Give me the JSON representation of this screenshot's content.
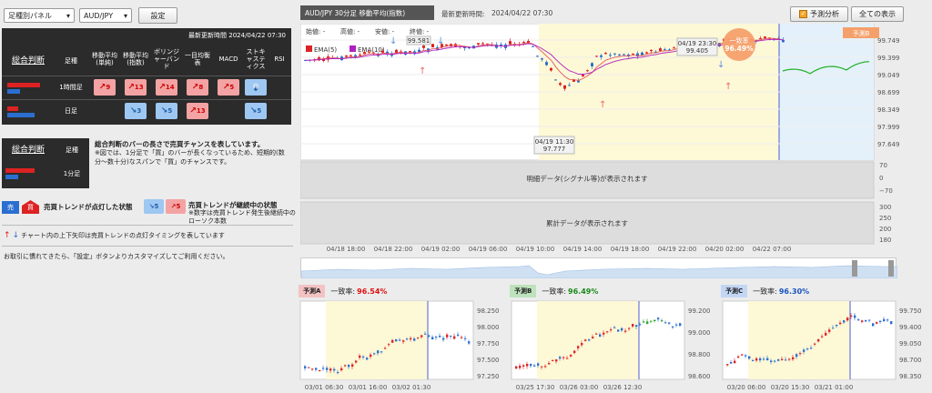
{
  "controls": {
    "panel_select": "足種別パネル",
    "pair_select": "AUD/JPY",
    "settings": "設定"
  },
  "signal_panel": {
    "updated": "最新更新時間 2024/04/22 07:30",
    "col_overall": "総合判断",
    "col_timeframe": "足種",
    "indicators": [
      "移動平均(単純)",
      "移動平均(指数)",
      "ボリンジャーバンド",
      "一目均衡表",
      "MACD",
      "ストキャスティクス",
      "RSI"
    ],
    "rows": [
      {
        "tf": "1時間足",
        "signals": [
          {
            "dir": "up",
            "n": "9"
          },
          {
            "dir": "up",
            "n": "13"
          },
          {
            "dir": "up",
            "n": "14"
          },
          {
            "dir": "up",
            "n": "8"
          },
          {
            "dir": "up",
            "n": "5"
          },
          {
            "dir": "sell",
            "n": "売"
          },
          {
            "dir": "none",
            "n": ""
          }
        ]
      },
      {
        "tf": "日足",
        "signals": [
          {
            "dir": "none",
            "n": ""
          },
          {
            "dir": "down",
            "n": "3"
          },
          {
            "dir": "down",
            "n": "5"
          },
          {
            "dir": "up",
            "n": "13"
          },
          {
            "dir": "none",
            "n": ""
          },
          {
            "dir": "down",
            "n": "5"
          },
          {
            "dir": "none",
            "n": ""
          }
        ]
      }
    ]
  },
  "legend": {
    "overall": "総合判断",
    "tf": "足種",
    "tf_value": "1分足",
    "desc_title": "総合判断のバーの長さで売買チャンスを表しています。",
    "desc_1": "※図では、1分足で「買」のバーが長くなっているため、短期的(数分〜数十分)なスパンで「買」のチャンスです。",
    "sell": "売",
    "buy": "買",
    "lit_text": "売買トレンドが点灯した状態",
    "cont_num": "5",
    "cont_text": "売買トレンドが継続中の状態",
    "cont_sub": "※数字は売買トレンド発生後継続中のローソク本数",
    "arrow_text": "チャート内の上下矢印は売買トレンドの点灯タイミングを表しています",
    "custom_text": "お取引に慣れてきたら、「設定」ボタンよりカスタマイズしてご利用ください。"
  },
  "main_chart": {
    "title": "AUD/JPY 30分足 移動平均(指数)",
    "updated_label": "最新更新時間:",
    "updated": "2024/04/22 07:30",
    "btn_predict": "予測分析",
    "btn_all": "全ての表示",
    "ohlc": {
      "open": "始値: -",
      "high": "高値: -",
      "low": "安値: -",
      "close": "終値: -"
    },
    "ema5": "EMA(5)",
    "ema10": "EMA(10)",
    "pred_tag": "予測B",
    "callout1": {
      "time": "04/19 23:30",
      "val": "99.405"
    },
    "callout2": {
      "time": "04/19 11:30",
      "val": "97.777"
    },
    "callout3": "99.581",
    "match_label": "一致率",
    "match_val": "96.49%",
    "y_ticks": [
      "99.749",
      "99.399",
      "99.049",
      "98.699",
      "98.349",
      "97.999",
      "97.649"
    ],
    "sub1_label": "明細データ(シグナル等)が表示されます",
    "sub1_ticks": [
      "70",
      "0",
      "−70"
    ],
    "sub2_label": "累計データが表示されます",
    "sub2_ticks": [
      "300",
      "250",
      "200",
      "180"
    ],
    "x_ticks": [
      "04/18 18:00",
      "04/18 22:00",
      "04/19 02:00",
      "04/19 06:00",
      "04/19 10:00",
      "04/19 14:00",
      "04/19 18:00",
      "04/19 22:00",
      "04/20 02:00",
      "04/22 07:00"
    ]
  },
  "predictions": [
    {
      "tag": "予測A",
      "tag_color": "#f3c3c3",
      "match_label": "一致率:",
      "match_val": "96.54%",
      "match_color": "#d11",
      "y_ticks": [
        "98.250",
        "98.000",
        "97.750",
        "97.500",
        "97.250"
      ],
      "x_ticks": [
        "03/01 06:30",
        "03/01 16:00",
        "03/02 01:30"
      ]
    },
    {
      "tag": "予測B",
      "tag_color": "#bde3bd",
      "match_label": "一致率:",
      "match_val": "96.49%",
      "match_color": "#1a8a1a",
      "y_ticks": [
        "99.200",
        "99.000",
        "98.800",
        "98.600"
      ],
      "x_ticks": [
        "03/25 17:30",
        "03/26 03:00",
        "03/26 12:30"
      ]
    },
    {
      "tag": "予測C",
      "tag_color": "#c3d6f3",
      "match_label": "一致率:",
      "match_val": "96.30%",
      "match_color": "#1a55c0",
      "y_ticks": [
        "99.750",
        "99.400",
        "99.050",
        "98.700",
        "98.350"
      ],
      "x_ticks": [
        "03/20 06:00",
        "03/20 15:30",
        "03/21 01:00"
      ]
    }
  ]
}
